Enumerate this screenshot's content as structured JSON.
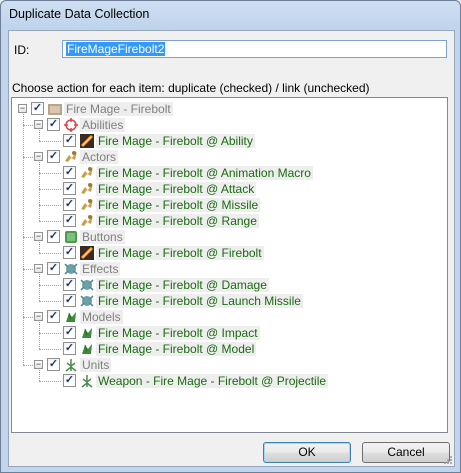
{
  "window": {
    "title": "Duplicate Data Collection"
  },
  "id_field": {
    "label": "ID:",
    "value": "FireMageFirebolt2"
  },
  "instructions": "Choose action for each item: duplicate (checked) / link (unchecked)",
  "tree": {
    "root": {
      "label": "Fire Mage - Firebolt",
      "checked": true
    },
    "groups": [
      {
        "label": "Abilities",
        "icon": "ability-icon",
        "items": [
          "Fire Mage - Firebolt @ Ability"
        ]
      },
      {
        "label": "Actors",
        "icon": "actor-icon",
        "items": [
          "Fire Mage - Firebolt @ Animation Macro",
          "Fire Mage - Firebolt @ Attack",
          "Fire Mage - Firebolt @ Missile",
          "Fire Mage - Firebolt @ Range"
        ]
      },
      {
        "label": "Buttons",
        "icon": "button-icon",
        "items": [
          "Fire Mage - Firebolt @ Firebolt"
        ]
      },
      {
        "label": "Effects",
        "icon": "effect-icon",
        "items": [
          "Fire Mage - Firebolt @ Damage",
          "Fire Mage - Firebolt @ Launch Missile"
        ]
      },
      {
        "label": "Models",
        "icon": "model-icon",
        "items": [
          "Fire Mage - Firebolt @ Impact",
          "Fire Mage - Firebolt @ Model"
        ]
      },
      {
        "label": "Units",
        "icon": "unit-icon",
        "items": [
          "Weapon - Fire Mage - Firebolt @ Projectile"
        ]
      }
    ]
  },
  "buttons": {
    "ok": "OK",
    "cancel": "Cancel"
  },
  "colors": {
    "item_text": "#1a6b10",
    "category_text": "#808080",
    "selection": "#3399ff"
  }
}
